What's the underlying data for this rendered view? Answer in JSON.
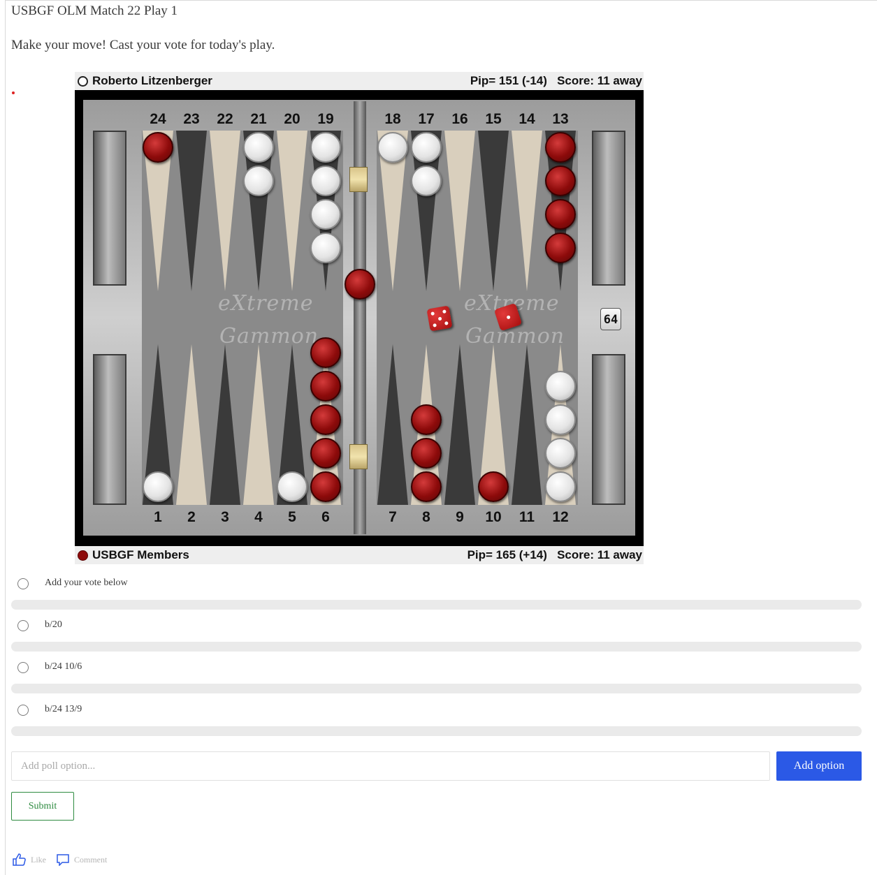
{
  "post": {
    "title": "USBGF OLM Match 22 Play 1",
    "body": "Make your move! Cast your vote for today's play."
  },
  "board": {
    "top_player": {
      "name": "Roberto Litzenberger",
      "stats": "Pip= 151 (-14)   Score: 11 away"
    },
    "bottom_player": {
      "name": "USBGF Members",
      "stats": "Pip= 165 (+14)   Score: 11 away"
    },
    "top_labels": [
      "24",
      "23",
      "22",
      "21",
      "20",
      "19",
      "18",
      "17",
      "16",
      "15",
      "14",
      "13"
    ],
    "bottom_labels": [
      "1",
      "2",
      "3",
      "4",
      "5",
      "6",
      "7",
      "8",
      "9",
      "10",
      "11",
      "12"
    ],
    "logo_line1": "eXtreme",
    "logo_line2": "Gammon",
    "cube_value": "64",
    "dice": [
      5,
      1
    ],
    "checker_colors": {
      "red": "#8e0b0b",
      "white": "#ececec"
    }
  },
  "poll": {
    "options": [
      {
        "label": "Add your vote below"
      },
      {
        "label": "b/20"
      },
      {
        "label": "b/24 10/6"
      },
      {
        "label": "b/24 13/9"
      }
    ],
    "add_placeholder": "Add poll option...",
    "add_button": "Add option",
    "submit_button": "Submit"
  },
  "footer": {
    "like_label": "Like",
    "comment_label": "Comment"
  },
  "colors": {
    "accent": "#2b59e6",
    "submit": "#2e8b40"
  }
}
